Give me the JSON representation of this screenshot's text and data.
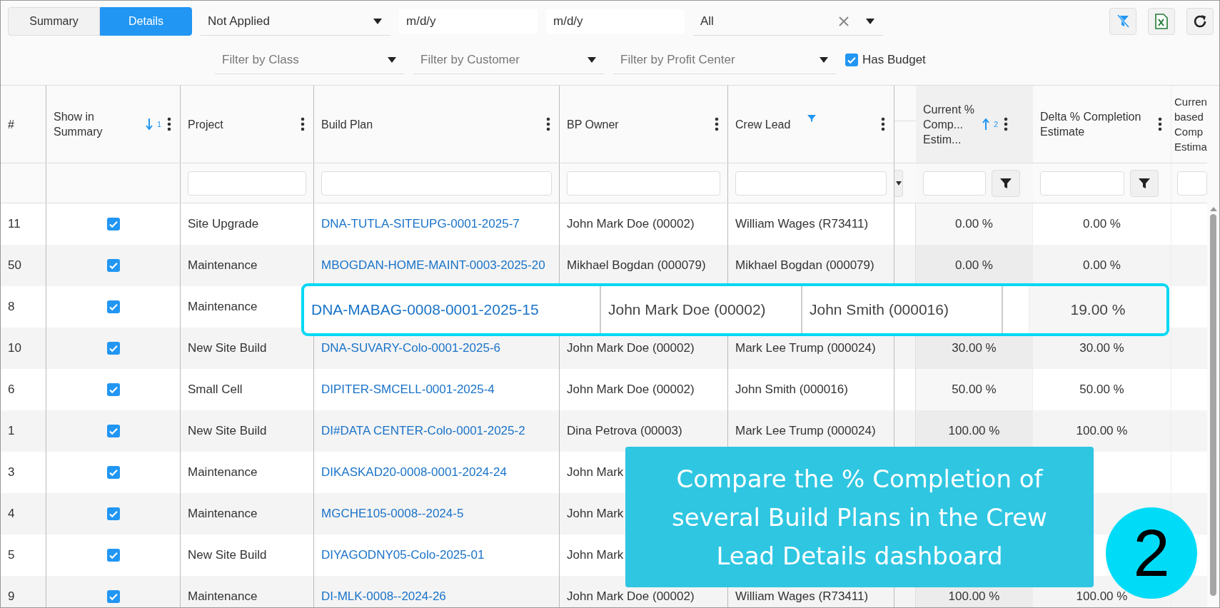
{
  "view_toggle": [
    {
      "label": "Summary",
      "selected": false
    },
    {
      "label": "Details",
      "selected": true
    }
  ],
  "filters_row_1": [
    {
      "kind": "dropdown",
      "value": "Not Applied"
    },
    {
      "kind": "date",
      "placeholder": "m/d/y"
    },
    {
      "kind": "date",
      "placeholder": "m/d/y"
    },
    {
      "kind": "dropdown",
      "value": "All",
      "clearable": true
    }
  ],
  "filters_row_2": [
    {
      "kind": "dropdown",
      "placeholder": "Filter by Class"
    },
    {
      "kind": "dropdown",
      "placeholder": "Filter by Customer"
    },
    {
      "kind": "dropdown",
      "placeholder": "Filter by Profit Center"
    },
    {
      "kind": "checkbox",
      "label": "Has Budget",
      "checked": true
    }
  ],
  "table": {
    "columns": [
      {
        "kind": "number",
        "label": "#"
      },
      {
        "kind": "check",
        "label": "Show in Summary",
        "sort_ascending": false,
        "sort_rank": "1",
        "menu": true
      },
      {
        "kind": "text",
        "label": "Project",
        "menu": true,
        "filter_field": true
      },
      {
        "kind": "link",
        "label": "Build Plan",
        "menu": true,
        "filter_field": true
      },
      {
        "kind": "text",
        "label": "BP Owner",
        "menu": true,
        "filter_field": true
      },
      {
        "kind": "text",
        "label": "Crew Lead",
        "menu": true,
        "filter_field": true,
        "filtered": true
      },
      {
        "kind": "collapsed"
      },
      {
        "kind": "percent",
        "label": "Current % Comp... Estim...",
        "sort_ascending": true,
        "sort_rank": "2",
        "menu": true,
        "filter_field": true,
        "filter_button": true,
        "shaded": true
      },
      {
        "kind": "percent",
        "label": "Delta % Completion Estimate",
        "menu": true,
        "filter_field": true,
        "filter_button": true
      },
      {
        "kind": "text",
        "label": "Curren based Comp Estima",
        "filter_field": true
      }
    ],
    "rows": [
      {
        "number": "11",
        "checked": true,
        "project": "Site Upgrade",
        "build_plan": "DNA-TUTLA-SITEUPG-0001-2025-7",
        "bp_owner": "John Mark Doe (00002)",
        "crew_lead": "William Wages (R73411)",
        "current_completion": "0.00 %",
        "delta_completion": "0.00 %"
      },
      {
        "number": "50",
        "checked": true,
        "project": "Maintenance",
        "build_plan": "MBOGDAN-HOME-MAINT-0003-2025-20",
        "bp_owner": "Mikhael Bogdan (000079)",
        "crew_lead": "Mikhael Bogdan (000079)",
        "current_completion": "0.00 %",
        "delta_completion": "0.00 %"
      },
      {
        "number": "8",
        "checked": true,
        "project": "Maintenance"
      },
      {
        "number": "10",
        "checked": true,
        "project": "New Site Build",
        "build_plan": "DNA-SUVARY-Colo-0001-2025-6",
        "bp_owner": "John Mark Doe (00002)",
        "crew_lead": "Mark Lee Trump (000024)",
        "current_completion": "30.00 %",
        "delta_completion": "30.00 %"
      },
      {
        "number": "6",
        "checked": true,
        "project": "Small Cell",
        "build_plan": "DIPITER-SMCELL-0001-2025-4",
        "bp_owner": "John Mark Doe (00002)",
        "crew_lead": "John Smith (000016)",
        "current_completion": "50.00 %",
        "delta_completion": "50.00 %"
      },
      {
        "number": "1",
        "checked": true,
        "project": "New Site Build",
        "build_plan": "DI#DATA CENTER-Colo-0001-2025-2",
        "bp_owner": "Dina Petrova (00003)",
        "crew_lead": "Mark Lee Trump (000024)",
        "current_completion": "100.00 %",
        "delta_completion": "100.00 %"
      },
      {
        "number": "3",
        "checked": true,
        "project": "Maintenance",
        "build_plan": "DIKASKAD20-0008-0001-2024-24",
        "bp_owner": "John Mark"
      },
      {
        "number": "4",
        "checked": true,
        "project": "Maintenance",
        "build_plan": "MGCHE105-0008--2024-5",
        "bp_owner": "John Mark"
      },
      {
        "number": "5",
        "checked": true,
        "project": "New Site Build",
        "build_plan": "DIYAGODNY05-Colo-2025-01",
        "bp_owner": "John Mark"
      },
      {
        "number": "9",
        "checked": true,
        "project": "Maintenance",
        "build_plan": "DI-MLK-0008--2024-26",
        "bp_owner": "John Mark Doe (00002)",
        "crew_lead": "William Wages (R73411)",
        "current_completion": "100.00 %",
        "delta_completion": "100.00 %"
      }
    ]
  },
  "highlight": {
    "build_plan": "DNA-MABAG-0008-0001-2025-15",
    "bp_owner": "John Mark Doe (00002)",
    "crew_lead": "John Smith (000016)",
    "current_completion": "19.00 %"
  },
  "callout": {
    "text": "Compare the % Completion of several Build Plans in the Crew Lead Details dashboard",
    "step": "2"
  }
}
